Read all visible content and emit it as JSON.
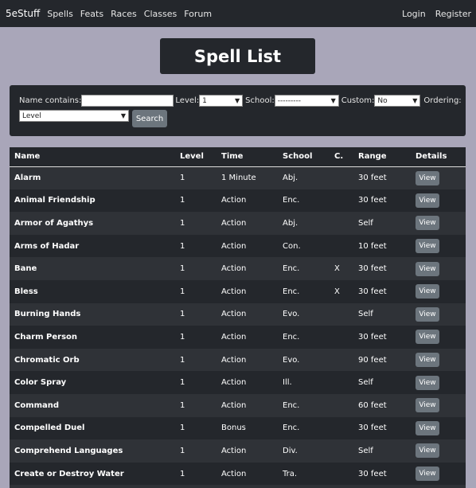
{
  "nav": {
    "brand": "5eStuff",
    "links": [
      "Spells",
      "Feats",
      "Races",
      "Classes",
      "Forum"
    ],
    "right": [
      "Login",
      "Register"
    ]
  },
  "page_title": "Spell List",
  "search": {
    "name_label": "Name contains:",
    "name_value": "",
    "level_label": "Level:",
    "level_value": "1",
    "school_label": "School:",
    "school_value": "---------",
    "custom_label": "Custom:",
    "custom_value": "No",
    "ordering_label": "Ordering:",
    "ordering_value": "Level",
    "button": "Search"
  },
  "table": {
    "headers": [
      "Name",
      "Level",
      "Time",
      "School",
      "C.",
      "Range",
      "Details"
    ],
    "rows": [
      {
        "name": "Alarm",
        "level": "1",
        "time": "1 Minute",
        "school": "Abj.",
        "c": "",
        "range": "30 feet",
        "details": "View"
      },
      {
        "name": "Animal Friendship",
        "level": "1",
        "time": "Action",
        "school": "Enc.",
        "c": "",
        "range": "30 feet",
        "details": "View"
      },
      {
        "name": "Armor of Agathys",
        "level": "1",
        "time": "Action",
        "school": "Abj.",
        "c": "",
        "range": "Self",
        "details": "View"
      },
      {
        "name": "Arms of Hadar",
        "level": "1",
        "time": "Action",
        "school": "Con.",
        "c": "",
        "range": "10 feet",
        "details": "View"
      },
      {
        "name": "Bane",
        "level": "1",
        "time": "Action",
        "school": "Enc.",
        "c": "X",
        "range": "30 feet",
        "details": "View"
      },
      {
        "name": "Bless",
        "level": "1",
        "time": "Action",
        "school": "Enc.",
        "c": "X",
        "range": "30 feet",
        "details": "View"
      },
      {
        "name": "Burning Hands",
        "level": "1",
        "time": "Action",
        "school": "Evo.",
        "c": "",
        "range": "Self",
        "details": "View"
      },
      {
        "name": "Charm Person",
        "level": "1",
        "time": "Action",
        "school": "Enc.",
        "c": "",
        "range": "30 feet",
        "details": "View"
      },
      {
        "name": "Chromatic Orb",
        "level": "1",
        "time": "Action",
        "school": "Evo.",
        "c": "",
        "range": "90 feet",
        "details": "View"
      },
      {
        "name": "Color Spray",
        "level": "1",
        "time": "Action",
        "school": "Ill.",
        "c": "",
        "range": "Self",
        "details": "View"
      },
      {
        "name": "Command",
        "level": "1",
        "time": "Action",
        "school": "Enc.",
        "c": "",
        "range": "60 feet",
        "details": "View"
      },
      {
        "name": "Compelled Duel",
        "level": "1",
        "time": "Bonus",
        "school": "Enc.",
        "c": "",
        "range": "30 feet",
        "details": "View"
      },
      {
        "name": "Comprehend Languages",
        "level": "1",
        "time": "Action",
        "school": "Div.",
        "c": "",
        "range": "Self",
        "details": "View"
      },
      {
        "name": "Create or Destroy Water",
        "level": "1",
        "time": "Action",
        "school": "Tra.",
        "c": "",
        "range": "30 feet",
        "details": "View"
      },
      {
        "name": "",
        "level": "",
        "time": "",
        "school": "",
        "c": "",
        "range": "",
        "details": ""
      }
    ]
  }
}
